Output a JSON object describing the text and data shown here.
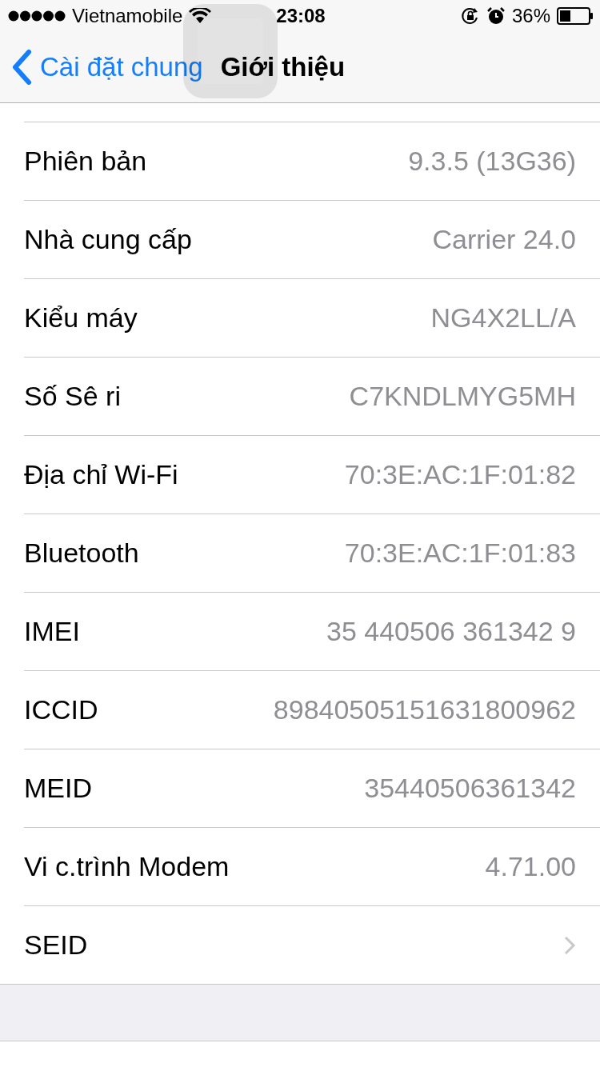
{
  "status_bar": {
    "carrier": "Vietnamobile",
    "time": "23:08",
    "battery": "36%"
  },
  "nav": {
    "back": "Cài đặt chung",
    "title": "Giới thiệu"
  },
  "rows": [
    {
      "kind": "value",
      "label": "Phiên bản",
      "value": "9.3.5 (13G36)"
    },
    {
      "kind": "value",
      "label": "Nhà cung cấp",
      "value": "Carrier 24.0"
    },
    {
      "kind": "value",
      "label": "Kiểu máy",
      "value": "NG4X2LL/A"
    },
    {
      "kind": "value",
      "label": "Số Sê ri",
      "value": "C7KNDLMYG5MH"
    },
    {
      "kind": "value",
      "label": "Địa chỉ Wi-Fi",
      "value": "70:3E:AC:1F:01:82"
    },
    {
      "kind": "value",
      "label": "Bluetooth",
      "value": "70:3E:AC:1F:01:83"
    },
    {
      "kind": "value",
      "label": "IMEI",
      "value": "35 440506 361342 9"
    },
    {
      "kind": "value",
      "label": "ICCID",
      "value": "89840505151631800962"
    },
    {
      "kind": "value",
      "label": "MEID",
      "value": "35440506361342"
    },
    {
      "kind": "value",
      "label": "Vi c.trình Modem",
      "value": "4.71.00"
    },
    {
      "kind": "disclosure",
      "label": "SEID"
    }
  ]
}
